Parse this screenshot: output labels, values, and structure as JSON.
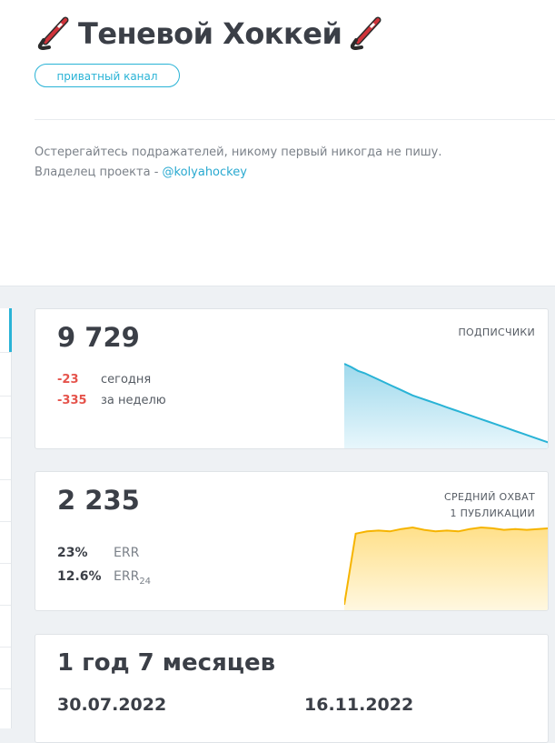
{
  "channel": {
    "title": "Теневой Хоккей",
    "badge": "приватный канал",
    "description_line1": "Остерегайтесь подражателей, никому первый никогда не пишу.",
    "owner_prefix": "Владелец проекта - ",
    "owner_handle": "@kolyahockey"
  },
  "subscribers": {
    "count": "9 729",
    "label": "ПОДПИСЧИКИ",
    "today_value": "-23",
    "today_label": "сегодня",
    "week_value": "-335",
    "week_label": "за неделю"
  },
  "reach": {
    "count": "2 235",
    "label_line1": "СРЕДНИЙ ОХВАТ",
    "label_line2": "1 ПУБЛИКАЦИИ",
    "err_value": "23%",
    "err_label": "ERR",
    "err24_value": "12.6%",
    "err24_label": "ERR",
    "err24_sub": "24"
  },
  "age": {
    "duration": "1 год 7 месяцев",
    "start_date": "30.07.2022",
    "end_date": "16.11.2022"
  },
  "colors": {
    "accent": "#29b3d6",
    "negative": "#e5534b",
    "reach_line": "#f6b400",
    "reach_fill": "#fff2c4"
  },
  "chart_data": [
    {
      "type": "area",
      "name": "subscribers_trend",
      "values": [
        100,
        96,
        91,
        88,
        84,
        80,
        76,
        72,
        68,
        64,
        60,
        57,
        54,
        51,
        48,
        45,
        42,
        39,
        36,
        33,
        30,
        27,
        24,
        21,
        18,
        15,
        12,
        9,
        6,
        3,
        0
      ]
    },
    {
      "type": "area",
      "name": "reach_trend",
      "values": [
        0,
        92,
        95,
        96,
        95,
        98,
        100,
        97,
        95,
        96,
        95,
        98,
        100,
        99,
        97,
        98,
        97,
        98,
        99
      ]
    }
  ]
}
